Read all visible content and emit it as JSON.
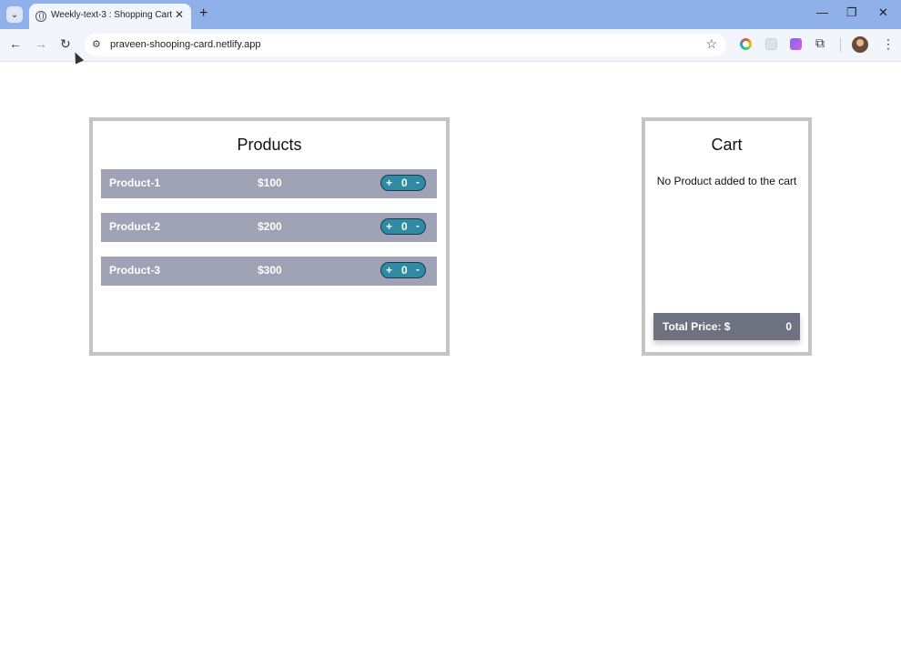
{
  "browser": {
    "tab_title": "Weekly-text-3 : Shopping Cart",
    "url": "praveen-shooping-card.netlify.app",
    "tab_close": "✕",
    "new_tab": "+",
    "minimize": "—",
    "restore": "❐",
    "close": "✕",
    "back": "←",
    "forward": "→",
    "reload": "↻",
    "star": "☆",
    "menu": "⋮"
  },
  "products": {
    "heading": "Products",
    "items": [
      {
        "name": "Product-1",
        "price": "$100",
        "plus": "+",
        "qty": "0",
        "minus": "-"
      },
      {
        "name": "Product-2",
        "price": "$200",
        "plus": "+",
        "qty": "0",
        "minus": "-"
      },
      {
        "name": "Product-3",
        "price": "$300",
        "plus": "+",
        "qty": "0",
        "minus": "-"
      }
    ]
  },
  "cart": {
    "heading": "Cart",
    "empty_message": "No Product added to the cart",
    "total_label": "Total Price: $",
    "total_value": "0"
  },
  "colors": {
    "tabbar": "#8fb0e8",
    "product_row": "#9fa2b4",
    "qty_pill": "#2e8ba3",
    "total_bar": "#6e7180",
    "panel_border": "#c4c4c4"
  }
}
